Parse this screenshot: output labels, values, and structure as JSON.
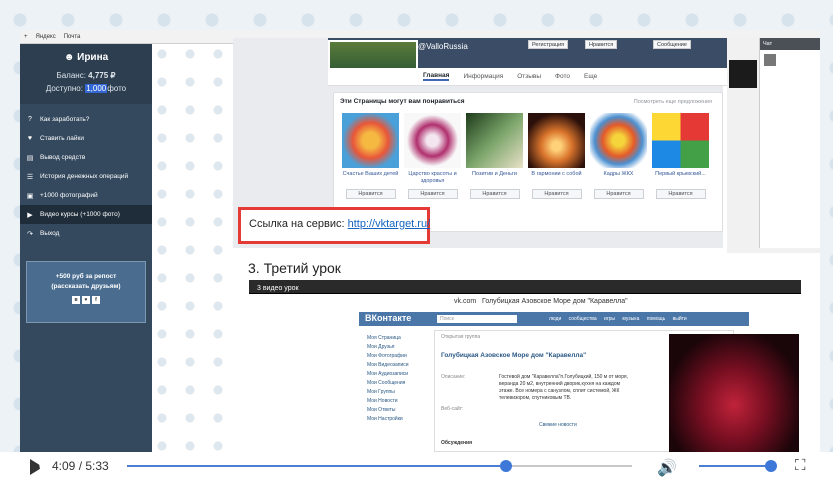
{
  "browser": {
    "plus": "+",
    "bookmarks": [
      "Яндекс",
      "Почта"
    ]
  },
  "sidebar": {
    "user_name": "Ирина",
    "balance_label": "Баланс:",
    "balance_value": "4,775 ₽",
    "available_label": "Доступно:",
    "available_value": "1,000",
    "available_suffix": "фото",
    "items": [
      {
        "icon": "question-icon",
        "label": "Как заработать?"
      },
      {
        "icon": "heart-icon",
        "label": "Ставить лайки"
      },
      {
        "icon": "card-icon",
        "label": "Вывод средств"
      },
      {
        "icon": "list-icon",
        "label": "История денежных операций"
      },
      {
        "icon": "cart-icon",
        "label": "+1000 фотографий"
      },
      {
        "icon": "play-icon",
        "label": "Видео курсы (+1000 фото)"
      },
      {
        "icon": "exit-icon",
        "label": "Выход"
      }
    ],
    "promo_line1": "+500 руб за репост",
    "promo_line2": "(рассказать друзьям)"
  },
  "facebook": {
    "page_name": "@ValloRussia",
    "btn_register": "Регистрация",
    "btn_like": "Нравится",
    "btn_message": "Сообщение",
    "tabs": [
      "Главная",
      "Информация",
      "Отзывы",
      "Фото",
      "Еще"
    ],
    "suggest_title": "Эти Страницы могут вам понравиться",
    "suggest_all": "Посмотреть еще предложения",
    "cards": [
      {
        "caption": "Счастье Ваших детей",
        "like": "Нравится"
      },
      {
        "caption": "Царство красоты и здоровья",
        "like": "Нравится"
      },
      {
        "caption": "Позитив и Деньги",
        "like": "Нравится"
      },
      {
        "caption": "В гармонии с собой",
        "like": "Нравится"
      },
      {
        "caption": "Кадры ЖКХ",
        "like": "Нравится"
      },
      {
        "caption": "Первый крымский...",
        "like": "Нравится"
      }
    ],
    "chat_label": "Чат"
  },
  "link_label": "Ссылка на сервис:",
  "link_url": "http://vktarget.ru/",
  "lesson_title": "3. Третий урок",
  "embedded": {
    "title": "3 видео урок",
    "page_url": "vk.com",
    "page_title": "Голубицкая Азовское Море дом \"Каравелла\"",
    "vk_logo": "ВКонтакте",
    "search_placeholder": "Поиск",
    "nav": "люди сообщества игры музыка помощь выйти",
    "side_links": [
      "Моя Страница",
      "Мои Друзья",
      "Мои Фотографии",
      "Мои Видеозаписи",
      "Мои Аудиозаписи",
      "Мои Сообщения",
      "Мои Группы",
      "Мои Новости",
      "Мои Ответы",
      "Мои Настройки"
    ],
    "section": "Открытая группа",
    "group_name": "Голубицкая Азовское Море дом \"Каравелла\"",
    "desc_label": "Описание:",
    "description": "Гостевой дом \"Каравелла\"п.Голубицкий, 150 м от моря, веранда 20 м2, внутренний дворик,кухня на каждом этаже. Все номера с санузлом, сплит системой, ЖК телевизором, спутниковым ТВ.",
    "site_label": "Веб-сайт:",
    "news": "Свежие новости",
    "discussions": "Обсуждения"
  },
  "player": {
    "time": "4:09 / 5:33",
    "progress": 0.75,
    "volume": 1.0
  }
}
